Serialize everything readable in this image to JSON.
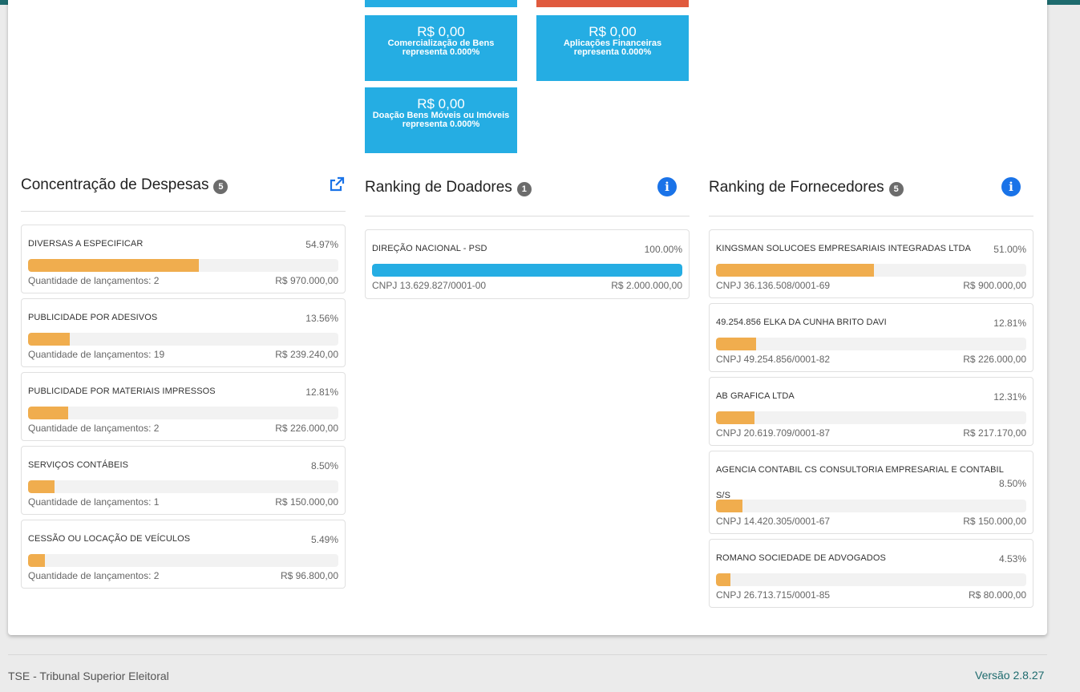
{
  "colors": {
    "tile": "#25ade3",
    "orange": "#f0ad4e",
    "blue_bar": "#25ade3",
    "accent_red": "#e05a3e",
    "info": "#1a73e8",
    "footer_accent": "#1e6b6e"
  },
  "tiles": [
    {
      "amount": "R$ 0,00",
      "label1": "Comercialização de Bens",
      "label2": "representa 0.000%"
    },
    {
      "amount": "R$ 0,00",
      "label1": "Aplicações Financeiras",
      "label2": "representa 0.000%"
    },
    {
      "amount": "R$ 0,00",
      "label1": "Doação Bens Móveis ou Imóveis",
      "label2": "representa 0.000%"
    }
  ],
  "despesas": {
    "title": "Concentração de Despesas",
    "count": "5",
    "items": [
      {
        "name": "DIVERSAS A ESPECIFICAR",
        "pct": "54.97%",
        "fraction": 0.5497,
        "qty": "Quantidade de lançamentos: 2",
        "value": "R$ 970.000,00"
      },
      {
        "name": "PUBLICIDADE POR ADESIVOS",
        "pct": "13.56%",
        "fraction": 0.1356,
        "qty": "Quantidade de lançamentos: 19",
        "value": "R$ 239.240,00"
      },
      {
        "name": "PUBLICIDADE POR MATERIAIS IMPRESSOS",
        "pct": "12.81%",
        "fraction": 0.1281,
        "qty": "Quantidade de lançamentos: 2",
        "value": "R$ 226.000,00"
      },
      {
        "name": "SERVIÇOS CONTÁBEIS",
        "pct": "8.50%",
        "fraction": 0.085,
        "qty": "Quantidade de lançamentos: 1",
        "value": "R$ 150.000,00"
      },
      {
        "name": "CESSÃO OU LOCAÇÃO DE VEÍCULOS",
        "pct": "5.49%",
        "fraction": 0.0549,
        "qty": "Quantidade de lançamentos: 2",
        "value": "R$ 96.800,00"
      }
    ]
  },
  "doadores": {
    "title": "Ranking de Doadores",
    "count": "1",
    "items": [
      {
        "name": "DIREÇÃO NACIONAL - PSD",
        "pct": "100.00%",
        "fraction": 1.0,
        "cnpj": "CNPJ 13.629.827/0001-00",
        "value": "R$ 2.000.000,00"
      }
    ]
  },
  "fornecedores": {
    "title": "Ranking de Fornecedores",
    "count": "5",
    "items": [
      {
        "name": "KINGSMAN SOLUCOES EMPRESARIAIS INTEGRADAS LTDA",
        "pct": "51.00%",
        "fraction": 0.51,
        "cnpj": "CNPJ 36.136.508/0001-69",
        "value": "R$ 900.000,00"
      },
      {
        "name": "49.254.856 ELKA DA CUNHA BRITO DAVI",
        "pct": "12.81%",
        "fraction": 0.1281,
        "cnpj": "CNPJ 49.254.856/0001-82",
        "value": "R$ 226.000,00"
      },
      {
        "name": "AB GRAFICA LTDA",
        "pct": "12.31%",
        "fraction": 0.1231,
        "cnpj": "CNPJ 20.619.709/0001-87",
        "value": "R$ 217.170,00"
      },
      {
        "name": "AGENCIA CONTABIL CS CONSULTORIA EMPRESARIAL E CONTABIL",
        "name2": "S/S",
        "pct": "8.50%",
        "fraction": 0.085,
        "cnpj": "CNPJ 14.420.305/0001-67",
        "value": "R$ 150.000,00"
      },
      {
        "name": "ROMANO SOCIEDADE DE ADVOGADOS",
        "pct": "4.53%",
        "fraction": 0.0453,
        "cnpj": "CNPJ 26.713.715/0001-85",
        "value": "R$ 80.000,00"
      }
    ]
  },
  "footer": {
    "left": "TSE - Tribunal Superior Eleitoral",
    "right": "Versão 2.8.27"
  }
}
